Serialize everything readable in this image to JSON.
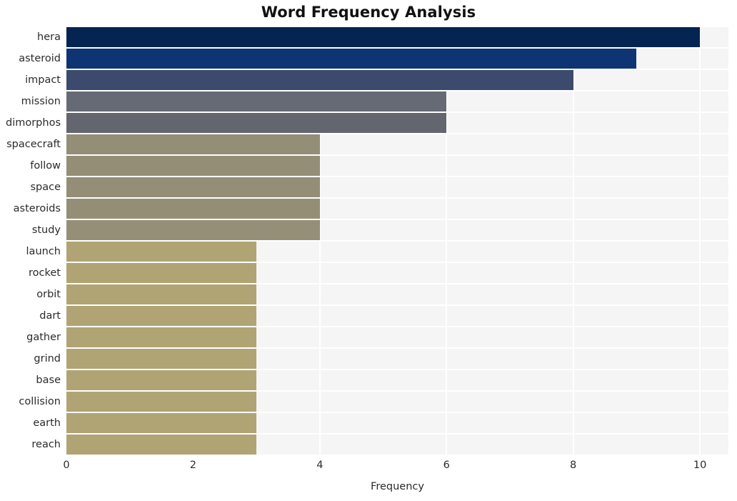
{
  "chart_data": {
    "type": "bar",
    "orientation": "horizontal",
    "title": "Word Frequency Analysis",
    "xlabel": "Frequency",
    "ylabel": "",
    "xlim": [
      0,
      10.45
    ],
    "xticks": [
      0,
      2,
      4,
      6,
      8,
      10
    ],
    "xtick_labels": [
      "0",
      "2",
      "4",
      "6",
      "8",
      "10"
    ],
    "grid": true,
    "legend": false,
    "plot_background": "#f5f5f6",
    "grid_color": "#ffffff",
    "figure_background": "#ffffff",
    "categories": [
      "hera",
      "asteroid",
      "impact",
      "mission",
      "dimorphos",
      "spacecraft",
      "follow",
      "space",
      "asteroids",
      "study",
      "launch",
      "rocket",
      "orbit",
      "dart",
      "gather",
      "grind",
      "base",
      "collision",
      "earth",
      "reach"
    ],
    "values": [
      10,
      9,
      8,
      6,
      6,
      4,
      4,
      4,
      4,
      4,
      3,
      3,
      3,
      3,
      3,
      3,
      3,
      3,
      3,
      3
    ],
    "bar_colors": [
      "#042451",
      "#0d3573",
      "#3b4a6d",
      "#666a74",
      "#63666f",
      "#948e77",
      "#948e77",
      "#948e77",
      "#948e77",
      "#958f78",
      "#b0a475",
      "#b0a475",
      "#b0a475",
      "#b0a475",
      "#b0a475",
      "#b0a475",
      "#b0a475",
      "#b0a475",
      "#b0a475",
      "#b0a475"
    ]
  }
}
